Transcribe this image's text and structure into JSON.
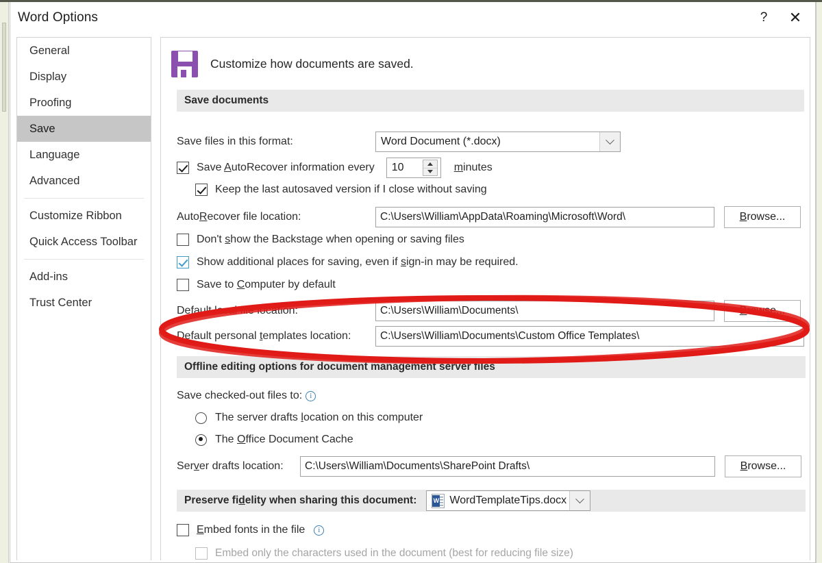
{
  "window": {
    "title": "Word Options",
    "help_label": "?",
    "close_label": "✕"
  },
  "sidebar": {
    "items": [
      {
        "label": "General",
        "selected": false
      },
      {
        "label": "Display",
        "selected": false
      },
      {
        "label": "Proofing",
        "selected": false
      },
      {
        "label": "Save",
        "selected": true
      },
      {
        "label": "Language",
        "selected": false
      },
      {
        "label": "Advanced",
        "selected": false
      },
      {
        "label": "Customize Ribbon",
        "selected": false
      },
      {
        "label": "Quick Access Toolbar",
        "selected": false
      },
      {
        "label": "Add-ins",
        "selected": false
      },
      {
        "label": "Trust Center",
        "selected": false
      }
    ]
  },
  "content": {
    "header": {
      "icon": "floppy-save-icon",
      "icon_color": "#8b4faf",
      "text": "Customize how documents are saved."
    },
    "save_documents": {
      "section_title": "Save documents",
      "save_format_label": "Save files in this format:",
      "save_format_value": "Word Document (*.docx)",
      "autorecover_checkbox_label": "Save AutoRecover information every",
      "autorecover_checked": true,
      "autorecover_minutes": "10",
      "minutes_label": "minutes",
      "keep_last_label": "Keep the last autosaved version if I close without saving",
      "keep_last_checked": true,
      "autorecover_location_label": "AutoRecover file location:",
      "autorecover_location_value": "C:\\Users\\William\\AppData\\Roaming\\Microsoft\\Word\\",
      "browse_label": "Browse...",
      "dont_show_backstage_label": "Don't show the Backstage when opening or saving files",
      "dont_show_backstage_checked": false,
      "show_additional_places_label": "Show additional places for saving, even if sign-in may be required.",
      "show_additional_places_checked": true,
      "show_additional_places_color": "#3f9bc9",
      "save_to_computer_label": "Save to Computer by default",
      "save_to_computer_checked": false,
      "default_local_label": "Default local file location:",
      "default_local_value": "C:\\Users\\William\\Documents\\",
      "default_templates_label": "Default personal templates location:",
      "default_templates_value": "C:\\Users\\William\\Documents\\Custom Office Templates\\"
    },
    "offline": {
      "section_title": "Offline editing options for document management server files",
      "save_checked_out_label": "Save checked-out files to:",
      "radio_server_drafts": "The server drafts location on this computer",
      "radio_office_cache": "The Office Document Cache",
      "selected_radio": "office_cache",
      "server_drafts_label": "Server drafts location:",
      "server_drafts_value": "C:\\Users\\William\\Documents\\SharePoint Drafts\\",
      "browse_label": "Browse..."
    },
    "preserve": {
      "section_title": "Preserve fidelity when sharing this document:",
      "document_value": "WordTemplateTips.docx",
      "embed_fonts_label": "Embed fonts in the file",
      "embed_fonts_checked": false,
      "embed_chars_label": "Embed only the characters used in the document (best for reducing file size)",
      "embed_chars_checked": false,
      "embed_chars_disabled": true
    }
  },
  "annotation": {
    "shape": "red-ellipse-highlight",
    "color": "#e01b17",
    "target": "Default personal templates location:"
  }
}
